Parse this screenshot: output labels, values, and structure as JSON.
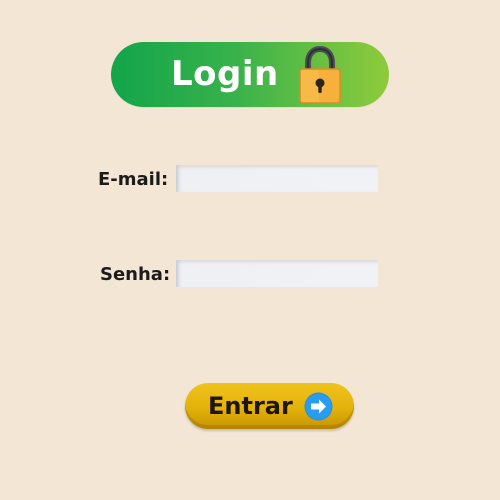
{
  "header": {
    "title": "Login",
    "icon": "lock-icon"
  },
  "form": {
    "email_label": "E-mail:",
    "email_value": "",
    "email_placeholder": "",
    "password_label": "Senha:",
    "password_value": "",
    "password_placeholder": ""
  },
  "actions": {
    "submit_label": "Entrar",
    "submit_icon": "arrow-right-icon"
  },
  "colors": {
    "background": "#f3e6d5",
    "header_green": "#12a54a",
    "header_green_light": "#8fcb3b",
    "button_gold": "#e3b20b",
    "arrow_blue": "#1f8fe8"
  }
}
